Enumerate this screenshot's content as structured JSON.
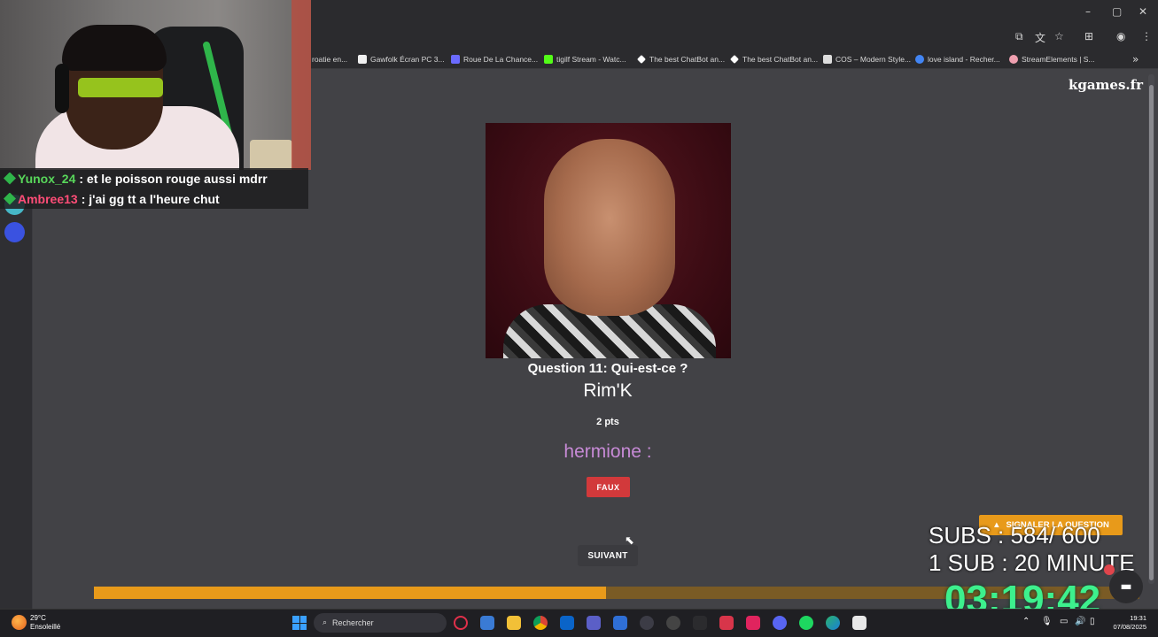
{
  "browser": {
    "bookmarks": [
      {
        "label": "roatie en...",
        "color": "#2b2b2e"
      },
      {
        "label": "Gawfolk Écran PC 3...",
        "color": "#f0f0f0"
      },
      {
        "label": "Roue De La Chance...",
        "color": "#6b6bff"
      },
      {
        "label": "tigilf Stream - Watc...",
        "color": "#53fc18"
      },
      {
        "label": "The best ChatBot an...",
        "color": "#ffffff"
      },
      {
        "label": "The best ChatBot an...",
        "color": "#ffffff"
      },
      {
        "label": "COS – Modern Style...",
        "color": "#dddddd"
      },
      {
        "label": "love island - Recher...",
        "color": "#4285f4"
      },
      {
        "label": "StreamElements | S...",
        "color": "#f0a0b0"
      }
    ]
  },
  "chat": [
    {
      "user": "Yunox_24",
      "message": ": et le poisson rouge aussi mdrr"
    },
    {
      "user": "Ambree13",
      "message": ": j'ai gg tt a l'heure chut"
    }
  ],
  "page": {
    "brand": "kgames.fr",
    "question": "Question 11: Qui-est-ce ?",
    "answer": "Rim'K",
    "points": "2 pts",
    "player": "hermione :",
    "result_label": "FAUX",
    "next_label": "SUIVANT",
    "report_label": "SIGNALER LA QUESTION",
    "progress_fraction": 0.49
  },
  "overlay": {
    "subs": "SUBS : 584/ 600",
    "sub_rule": "1 SUB :  20 MINUTE",
    "timer": "03:19:42"
  },
  "taskbar": {
    "weather_temp": "29°C",
    "weather_desc": "Ensoleillé",
    "search_placeholder": "Rechercher",
    "time": "19:31",
    "date": "07/08/2025"
  },
  "colors": {
    "accent": "#e89a1a",
    "wrong": "#d2393b",
    "player": "#c78ad6",
    "timer": "#3df08d"
  },
  "icons": [
    "minimize-icon",
    "maximize-icon",
    "close-icon",
    "star-icon",
    "extensions-icon",
    "menu-icon",
    "warning-icon",
    "chat-icon",
    "search-icon",
    "windows-icon"
  ]
}
